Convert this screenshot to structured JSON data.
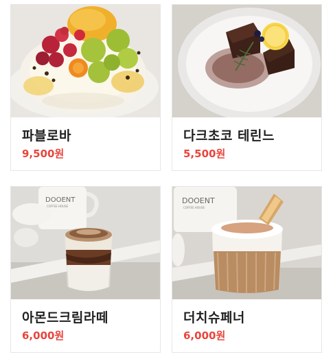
{
  "colors": {
    "price": "#e8453c",
    "name": "#1f1f1f",
    "card_border": "#e6e6e6"
  },
  "menu": {
    "items": [
      {
        "name": "파블로바",
        "price": "9,500원",
        "image_icon": "pavlova-photo-icon"
      },
      {
        "name": "다크초코 테린느",
        "price": "5,500원",
        "image_icon": "chocolate-terrine-photo-icon"
      },
      {
        "name": "아몬드크림라떼",
        "price": "6,000원",
        "image_icon": "almond-cream-latte-photo-icon"
      },
      {
        "name": "더치슈페너",
        "price": "6,000원",
        "image_icon": "dutch-einspanner-photo-icon"
      }
    ],
    "cup_logo_text": "DOOENT",
    "cup_logo_subtext": "COFFEE HOUSE"
  }
}
